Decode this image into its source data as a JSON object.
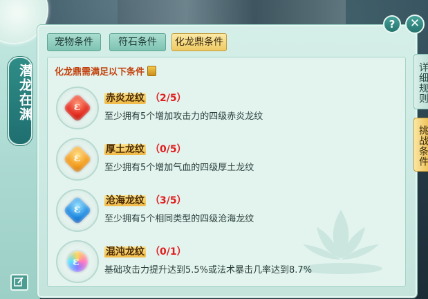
{
  "sidebar": {
    "title": "潜龙在渊"
  },
  "tabs": [
    {
      "label": "宠物条件",
      "active": false
    },
    {
      "label": "符石条件",
      "active": false
    },
    {
      "label": "化龙鼎条件",
      "active": true
    }
  ],
  "side_tabs": {
    "rules": "详细规则",
    "challenge": "挑战条件"
  },
  "controls": {
    "help": "?",
    "close": "✕"
  },
  "content": {
    "header": "化龙鼎需满足以下条件",
    "entries": [
      {
        "name": "赤炎龙纹",
        "progress": "（2/5）",
        "desc": "至少拥有5个增加攻击力的四级赤炎龙纹",
        "icon": "red-dragon-rune-icon",
        "color": "#e3281c"
      },
      {
        "name": "厚土龙纹",
        "progress": "（0/5）",
        "desc": "至少拥有5个增加气血的四级厚土龙纹",
        "icon": "earth-dragon-rune-icon",
        "color": "#f29a1a"
      },
      {
        "name": "沧海龙纹",
        "progress": "（3/5）",
        "desc": "至少拥有5个相同类型的四级沧海龙纹",
        "icon": "sea-dragon-rune-icon",
        "color": "#1d88e0"
      },
      {
        "name": "混沌龙纹",
        "progress": "（0/1）",
        "desc": "基础攻击力提升达到5.5%或法术暴击几率达到8.7%",
        "icon": "chaos-dragon-rune-icon",
        "color": "#8a7bff"
      }
    ]
  }
}
